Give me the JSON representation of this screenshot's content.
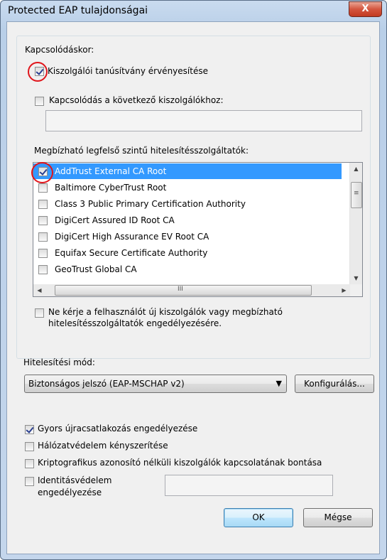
{
  "window": {
    "title": "Protected EAP tulajdonságai",
    "close_glyph": "X"
  },
  "connect_section": {
    "label": "Kapcsolódáskor:",
    "validate_cert": {
      "label": "Kiszolgálói tanúsítvány érvényesítése",
      "checked": true
    },
    "connect_to_servers": {
      "label": "Kapcsolódás a következő kiszolgálókhoz:",
      "checked": false,
      "value": ""
    }
  },
  "trusted_roots": {
    "label": "Megbízható legfelső szintű hitelesítésszolgáltatók:",
    "items": [
      {
        "label": "AddTrust External CA Root",
        "checked": true,
        "selected": true
      },
      {
        "label": "Baltimore CyberTrust Root",
        "checked": false,
        "selected": false
      },
      {
        "label": "Class 3 Public Primary Certification Authority",
        "checked": false,
        "selected": false
      },
      {
        "label": "DigiCert Assured ID Root CA",
        "checked": false,
        "selected": false
      },
      {
        "label": "DigiCert High Assurance EV Root CA",
        "checked": false,
        "selected": false
      },
      {
        "label": "Equifax Secure Certificate Authority",
        "checked": false,
        "selected": false
      },
      {
        "label": "GeoTrust Global CA",
        "checked": false,
        "selected": false
      }
    ],
    "scroll": {
      "up": "▲",
      "down": "▼",
      "left": "◀",
      "right": "▶",
      "vgrip": "≡",
      "hgrip": "III"
    }
  },
  "dont_prompt": {
    "line1": "Ne kérje a felhasználót új kiszolgálók vagy megbízható",
    "line2": "hitelesítésszolgáltatók engedélyezésére.",
    "checked": false
  },
  "auth_method": {
    "label": "Hitelesítési mód:",
    "selected": "Biztonságos jelszó (EAP-MSCHAP v2)",
    "arrow": "▼",
    "configure_label": "Konfigurálás..."
  },
  "options": [
    {
      "label": "Gyors újracsatlakozás engedélyezése",
      "checked": true
    },
    {
      "label": "Hálózatvédelem kényszerítése",
      "checked": false
    },
    {
      "label": "Kriptografikus azonosító nélküli kiszolgálók kapcsolatának bontása",
      "checked": false
    }
  ],
  "identity_privacy": {
    "line1": "Identitásvédelem",
    "line2": "engedélyezése",
    "checked": false,
    "value": ""
  },
  "buttons": {
    "ok": "OK",
    "cancel": "Mégse"
  },
  "colors": {
    "selection": "#3399ff",
    "annotation_circle": "#e0151b",
    "close_button": "#c13a21"
  }
}
